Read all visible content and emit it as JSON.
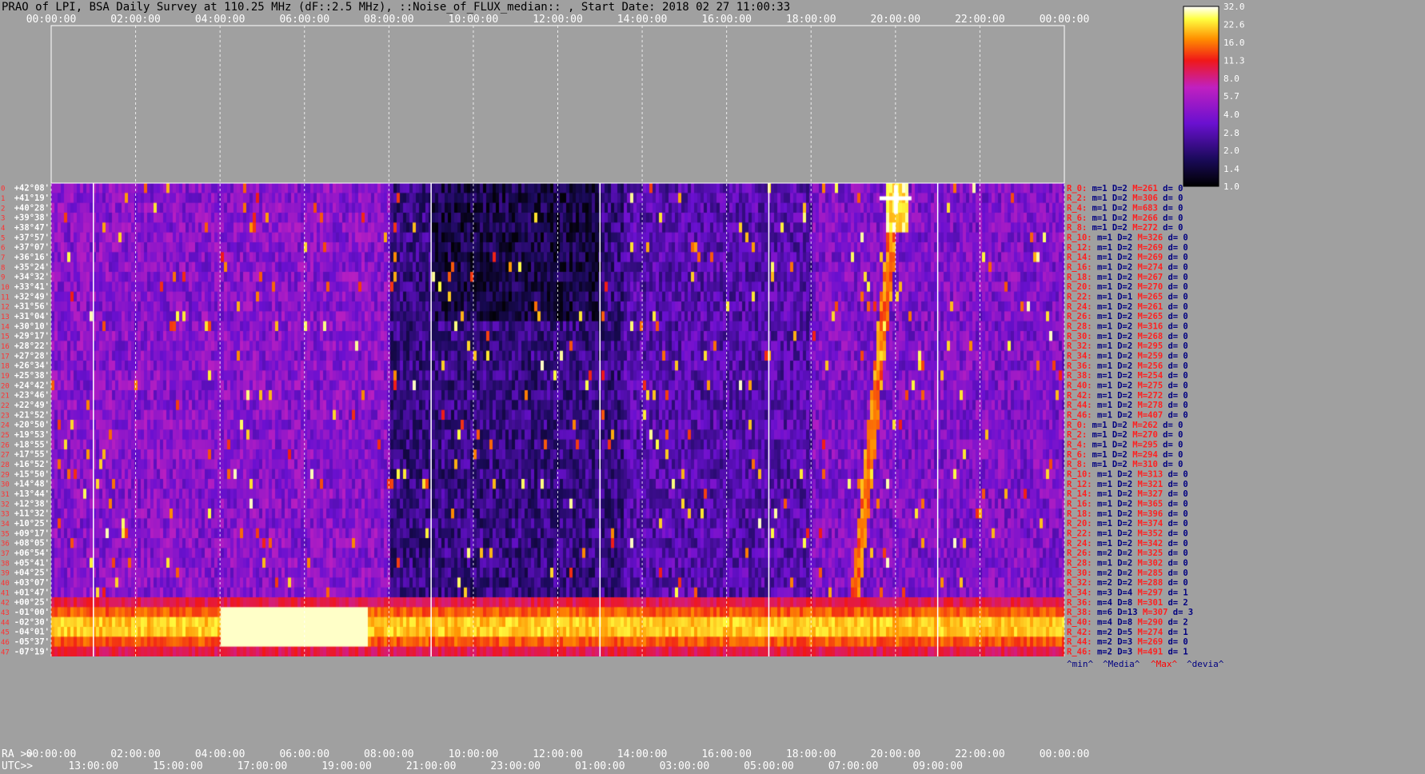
{
  "chart_data": {
    "type": "heatmap",
    "title": "PRAO of LPI, BSA Daily Survey at 110.25 MHz (dF::2.5 MHz), ::Noise_of_FLUX_median:: , Start Date: 2018 02 27 11:00:33",
    "top_time_ticks": [
      "00:00:00",
      "02:00:00",
      "04:00:00",
      "06:00:00",
      "08:00:00",
      "10:00:00",
      "12:00:00",
      "14:00:00",
      "16:00:00",
      "18:00:00",
      "20:00:00",
      "22:00:00",
      "00:00:00"
    ],
    "bottom_ra_ticks": [
      "00:00:00",
      "02:00:00",
      "04:00:00",
      "06:00:00",
      "08:00:00",
      "10:00:00",
      "12:00:00",
      "14:00:00",
      "16:00:00",
      "18:00:00",
      "20:00:00",
      "22:00:00",
      "00:00:00"
    ],
    "bottom_utc_ticks": [
      "13:00:00",
      "15:00:00",
      "17:00:00",
      "19:00:00",
      "21:00:00",
      "23:00:00",
      "01:00:00",
      "03:00:00",
      "05:00:00",
      "07:00:00",
      "09:00:00"
    ],
    "ra_prefix": "RA >>",
    "utc_prefix": "UTC>>",
    "declinations": [
      "+42°08'",
      "+41°19'",
      "+40°28'",
      "+39°38'",
      "+38°47'",
      "+37°57'",
      "+37°07'",
      "+36°16'",
      "+35°24'",
      "+34°32'",
      "+33°41'",
      "+32°49'",
      "+31°56'",
      "+31°04'",
      "+30°10'",
      "+29°17'",
      "+28°22'",
      "+27°28'",
      "+26°34'",
      "+25°38'",
      "+24°42'",
      "+23°46'",
      "+22°49'",
      "+21°52'",
      "+20°50'",
      "+19°53'",
      "+18°55'",
      "+17°55'",
      "+16°52'",
      "+15°50'",
      "+14°48'",
      "+13°44'",
      "+12°38'",
      "+11°32'",
      "+10°25'",
      "+09°17'",
      "+08°05'",
      "+06°54'",
      "+05°41'",
      "+04°25'",
      "+03°07'",
      "+01°47'",
      "+00°25'",
      "-01°00'",
      "-02°30'",
      "-04°01'",
      "-05°37'",
      "-07°19'"
    ],
    "colorbar_ticks": [
      "32.0",
      "22.6",
      "16.0",
      "11.3",
      "8.0",
      "5.7",
      "4.0",
      "2.8",
      "2.0",
      "1.4",
      "1.0"
    ],
    "colorbar_scale": "log",
    "colorbar_range": [
      1.0,
      32.0
    ],
    "colormap": [
      "#000000",
      "#1a0a5a",
      "#6a10d0",
      "#c020c0",
      "#f01818",
      "#ff9000",
      "#ffff40",
      "#ffffff"
    ],
    "row_stats": [
      {
        "label": "R_0:",
        "m": 1,
        "D": 2,
        "M": 261,
        "d": 0
      },
      {
        "label": "R_2:",
        "m": 1,
        "D": 2,
        "M": 306,
        "d": 0
      },
      {
        "label": "R_4:",
        "m": 1,
        "D": 2,
        "M": 683,
        "d": 0
      },
      {
        "label": "R_6:",
        "m": 1,
        "D": 2,
        "M": 266,
        "d": 0
      },
      {
        "label": "R_8:",
        "m": 1,
        "D": 2,
        "M": 272,
        "d": 0
      },
      {
        "label": "R_10:",
        "m": 1,
        "D": 2,
        "M": 326,
        "d": 0
      },
      {
        "label": "R_12:",
        "m": 1,
        "D": 2,
        "M": 269,
        "d": 0
      },
      {
        "label": "R_14:",
        "m": 1,
        "D": 2,
        "M": 269,
        "d": 0
      },
      {
        "label": "R_16:",
        "m": 1,
        "D": 2,
        "M": 274,
        "d": 0
      },
      {
        "label": "R_18:",
        "m": 1,
        "D": 2,
        "M": 267,
        "d": 0
      },
      {
        "label": "R_20:",
        "m": 1,
        "D": 2,
        "M": 270,
        "d": 0
      },
      {
        "label": "R_22:",
        "m": 1,
        "D": 1,
        "M": 265,
        "d": 0
      },
      {
        "label": "R_24:",
        "m": 1,
        "D": 2,
        "M": 261,
        "d": 0
      },
      {
        "label": "R_26:",
        "m": 1,
        "D": 2,
        "M": 265,
        "d": 0
      },
      {
        "label": "R_28:",
        "m": 1,
        "D": 2,
        "M": 316,
        "d": 0
      },
      {
        "label": "R_30:",
        "m": 1,
        "D": 2,
        "M": 268,
        "d": 0
      },
      {
        "label": "R_32:",
        "m": 1,
        "D": 2,
        "M": 295,
        "d": 0
      },
      {
        "label": "R_34:",
        "m": 1,
        "D": 2,
        "M": 259,
        "d": 0
      },
      {
        "label": "R_36:",
        "m": 1,
        "D": 2,
        "M": 256,
        "d": 0
      },
      {
        "label": "R_38:",
        "m": 1,
        "D": 2,
        "M": 254,
        "d": 0
      },
      {
        "label": "R_40:",
        "m": 1,
        "D": 2,
        "M": 275,
        "d": 0
      },
      {
        "label": "R_42:",
        "m": 1,
        "D": 2,
        "M": 272,
        "d": 0
      },
      {
        "label": "R_44:",
        "m": 1,
        "D": 2,
        "M": 278,
        "d": 0
      },
      {
        "label": "R_46:",
        "m": 1,
        "D": 2,
        "M": 407,
        "d": 0
      },
      {
        "label": "R_0:",
        "m": 1,
        "D": 2,
        "M": 262,
        "d": 0
      },
      {
        "label": "R_2:",
        "m": 1,
        "D": 2,
        "M": 270,
        "d": 0
      },
      {
        "label": "R_4:",
        "m": 1,
        "D": 2,
        "M": 295,
        "d": 0
      },
      {
        "label": "R_6:",
        "m": 1,
        "D": 2,
        "M": 294,
        "d": 0
      },
      {
        "label": "R_8:",
        "m": 1,
        "D": 2,
        "M": 310,
        "d": 0
      },
      {
        "label": "R_10:",
        "m": 1,
        "D": 2,
        "M": 313,
        "d": 0
      },
      {
        "label": "R_12:",
        "m": 1,
        "D": 2,
        "M": 321,
        "d": 0
      },
      {
        "label": "R_14:",
        "m": 1,
        "D": 2,
        "M": 327,
        "d": 0
      },
      {
        "label": "R_16:",
        "m": 1,
        "D": 2,
        "M": 365,
        "d": 0
      },
      {
        "label": "R_18:",
        "m": 1,
        "D": 2,
        "M": 396,
        "d": 0
      },
      {
        "label": "R_20:",
        "m": 1,
        "D": 2,
        "M": 374,
        "d": 0
      },
      {
        "label": "R_22:",
        "m": 1,
        "D": 2,
        "M": 352,
        "d": 0
      },
      {
        "label": "R_24:",
        "m": 1,
        "D": 2,
        "M": 342,
        "d": 0
      },
      {
        "label": "R_26:",
        "m": 2,
        "D": 2,
        "M": 325,
        "d": 0
      },
      {
        "label": "R_28:",
        "m": 1,
        "D": 2,
        "M": 302,
        "d": 0
      },
      {
        "label": "R_30:",
        "m": 2,
        "D": 2,
        "M": 285,
        "d": 0
      },
      {
        "label": "R_32:",
        "m": 2,
        "D": 2,
        "M": 288,
        "d": 0
      },
      {
        "label": "R_34:",
        "m": 3,
        "D": 4,
        "M": 297,
        "d": 1
      },
      {
        "label": "R_36:",
        "m": 4,
        "D": 8,
        "M": 301,
        "d": 2
      },
      {
        "label": "R_38:",
        "m": 6,
        "D": 13,
        "M": 307,
        "d": 3
      },
      {
        "label": "R_40:",
        "m": 4,
        "D": 8,
        "M": 290,
        "d": 2
      },
      {
        "label": "R_42:",
        "m": 2,
        "D": 5,
        "M": 274,
        "d": 1
      },
      {
        "label": "R_44:",
        "m": 2,
        "D": 3,
        "M": 269,
        "d": 0
      },
      {
        "label": "R_46:",
        "m": 2,
        "D": 3,
        "M": 491,
        "d": 1
      }
    ],
    "legend_labels": [
      {
        "text": "^min^",
        "color": "#000080"
      },
      {
        "text": "^Media^",
        "color": "#000080"
      },
      {
        "text": "^Max^",
        "color": "#ff0000"
      },
      {
        "text": "^devia^",
        "color": "#000080"
      }
    ],
    "features": {
      "horizontal_band_rows": [
        42,
        47
      ],
      "bright_source_time_h": 20.0,
      "drift_track": {
        "from_h": 19.0,
        "to_h": 20.0
      }
    }
  }
}
